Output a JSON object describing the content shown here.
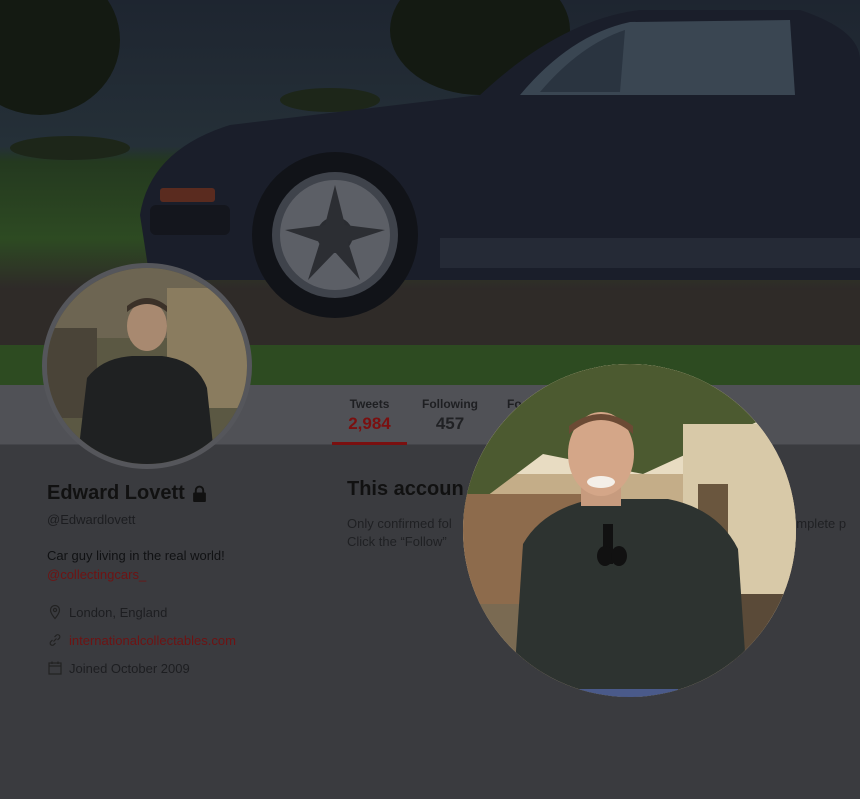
{
  "profile": {
    "name": "Edward Lovett",
    "handle": "@Edwardlovett",
    "bio": "Car guy living in the real world!",
    "bio_link": "@collectingcars_",
    "location": "London, England",
    "website": "internationalcollectables.com",
    "joined": "Joined October 2009"
  },
  "stats": [
    {
      "label": "Tweets",
      "value": "2,984",
      "active": true
    },
    {
      "label": "Following",
      "value": "457",
      "active": false
    },
    {
      "label": "Fo",
      "value": "",
      "active": false
    }
  ],
  "protected": {
    "title": "This accoun",
    "line1": "Only confirmed fol",
    "line1_end": "omplete p",
    "line2": "Click the “Follow”"
  },
  "colors": {
    "accent": "#7a1010",
    "overlay_background": "#3a3b3f"
  },
  "icons": [
    "lock-icon",
    "location-icon",
    "link-icon",
    "calendar-icon"
  ]
}
